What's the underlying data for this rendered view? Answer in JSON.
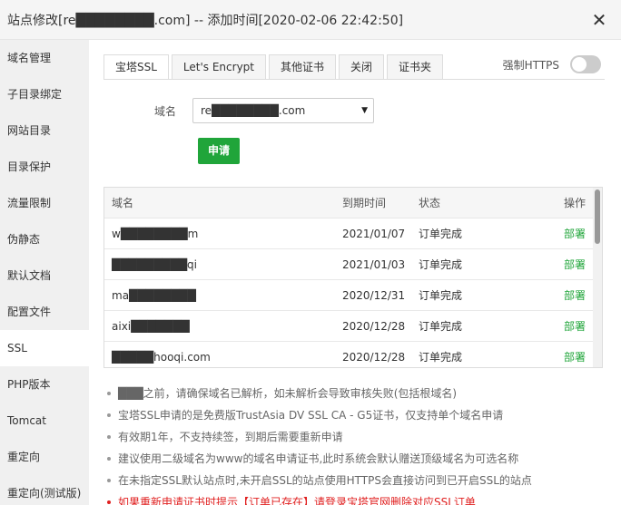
{
  "window": {
    "title": "站点修改[re████████.com] -- 添加时间[2020-02-06 22:42:50]",
    "close_symbol": "✕"
  },
  "sidebar": {
    "items": [
      {
        "label": "域名管理"
      },
      {
        "label": "子目录绑定"
      },
      {
        "label": "网站目录"
      },
      {
        "label": "目录保护"
      },
      {
        "label": "流量限制"
      },
      {
        "label": "伪静态"
      },
      {
        "label": "默认文档"
      },
      {
        "label": "配置文件"
      },
      {
        "label": "SSL"
      },
      {
        "label": "PHP版本"
      },
      {
        "label": "Tomcat"
      },
      {
        "label": "重定向"
      },
      {
        "label": "重定向(测试版)"
      }
    ],
    "active": "SSL"
  },
  "tabs": [
    {
      "label": "宝塔SSL"
    },
    {
      "label": "Let's Encrypt"
    },
    {
      "label": "其他证书"
    },
    {
      "label": "关闭"
    },
    {
      "label": "证书夹"
    }
  ],
  "force_https": {
    "label": "强制HTTPS",
    "enabled": false
  },
  "domain_select": {
    "label": "域名",
    "value": "re████████.com",
    "arrow": "▼"
  },
  "apply_button": {
    "label": "申请"
  },
  "table": {
    "headers": [
      "域名",
      "到期时间",
      "状态",
      "操作"
    ],
    "rows": [
      {
        "domain": "w████████m",
        "expires": "2021/01/07",
        "status": "订单完成",
        "action": "部署"
      },
      {
        "domain": "█████████qi",
        "expires": "2021/01/03",
        "status": "订单完成",
        "action": "部署"
      },
      {
        "domain": "ma████████",
        "expires": "2020/12/31",
        "status": "订单完成",
        "action": "部署"
      },
      {
        "domain": "aixi███████",
        "expires": "2020/12/28",
        "status": "订单完成",
        "action": "部署"
      },
      {
        "domain": "█████hooqi.com",
        "expires": "2020/12/28",
        "status": "订单完成",
        "action": "部署"
      }
    ]
  },
  "notes": [
    {
      "text": "███之前，请确保域名已解析，如未解析会导致审核失败(包括根域名)",
      "warning": false
    },
    {
      "text": "宝塔SSL申请的是免费版TrustAsia DV SSL CA - G5证书，仅支持单个域名申请",
      "warning": false
    },
    {
      "text": "有效期1年，不支持续签，到期后需要重新申请",
      "warning": false
    },
    {
      "text": "建议使用二级域名为www的域名申请证书,此时系统会默认赠送顶级域名为可选名称",
      "warning": false
    },
    {
      "text": "在未指定SSL默认站点时,未开启SSL的站点使用HTTPS会直接访问到已开启SSL的站点",
      "warning": false
    },
    {
      "text": "如果重新申请证书时提示【订单已存在】请登录宝塔官网删除对应SSL订单",
      "warning": true
    }
  ],
  "colors": {
    "accent": "#20a53a",
    "warning": "#e02020"
  }
}
